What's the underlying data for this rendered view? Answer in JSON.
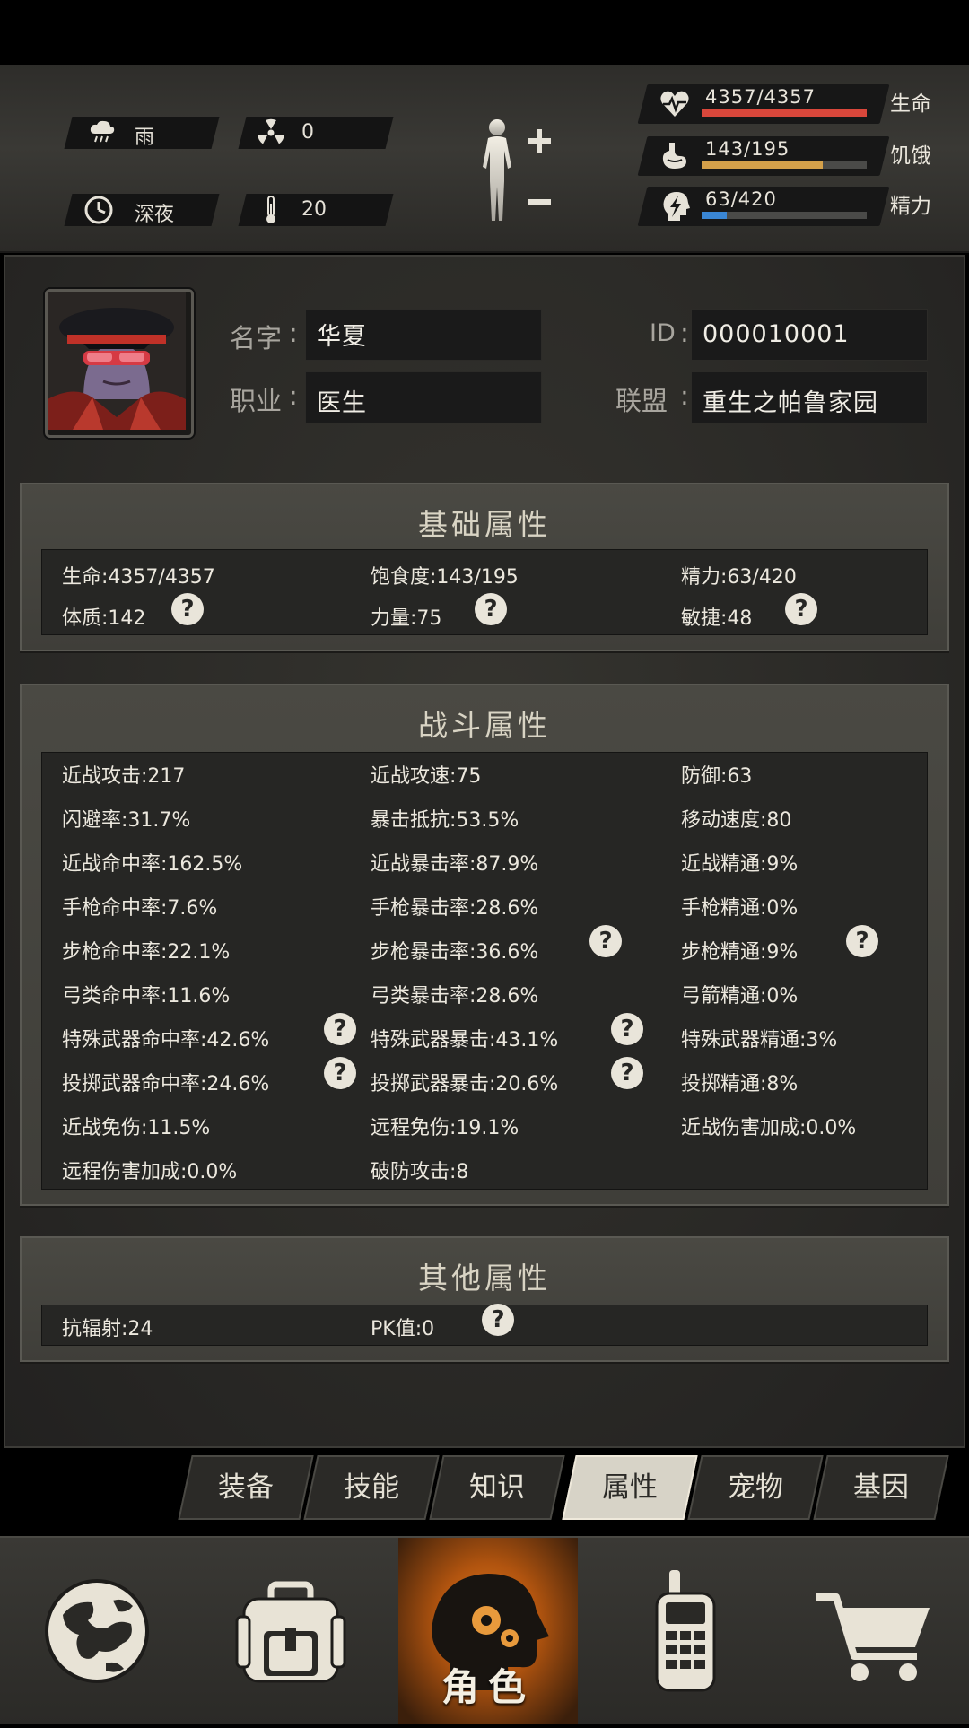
{
  "env": {
    "weather": "雨",
    "radiation": "0",
    "time": "深夜",
    "temperature": "20"
  },
  "stats": {
    "hp": {
      "value": "4357/4357",
      "label": "生命",
      "fraction": 1.0,
      "color": "#d9473b"
    },
    "hunger": {
      "value": "143/195",
      "label": "饥饿",
      "fraction": 0.733,
      "color": "#d4a04a"
    },
    "energy": {
      "value": "63/420",
      "label": "精力",
      "fraction": 0.15,
      "color": "#3a86d4"
    }
  },
  "profile": {
    "name_label": "名字",
    "name": "华夏",
    "id_label": "ID",
    "id": "000010001",
    "job_label": "职业",
    "job": "医生",
    "alliance_label": "联盟",
    "alliance": "重生之帕鲁家园"
  },
  "basic": {
    "title": "基础属性",
    "items": [
      "生命:4357/4357",
      "饱食度:143/195",
      "精力:63/420",
      "体质:142",
      "力量:75",
      "敏捷:48"
    ]
  },
  "combat": {
    "title": "战斗属性",
    "items": [
      "近战攻击:217",
      "近战攻速:75",
      "防御:63",
      "闪避率:31.7%",
      "暴击抵抗:53.5%",
      "移动速度:80",
      "近战命中率:162.5%",
      "近战暴击率:87.9%",
      "近战精通:9%",
      "手枪命中率:7.6%",
      "手枪暴击率:28.6%",
      "手枪精通:0%",
      "步枪命中率:22.1%",
      "步枪暴击率:36.6%",
      "步枪精通:9%",
      "弓类命中率:11.6%",
      "弓类暴击率:28.6%",
      "弓箭精通:0%",
      "特殊武器命中率:42.6%",
      "特殊武器暴击:43.1%",
      "特殊武器精通:3%",
      "投掷武器命中率:24.6%",
      "投掷武器暴击:20.6%",
      "投掷精通:8%",
      "近战免伤:11.5%",
      "远程免伤:19.1%",
      "近战伤害加成:0.0%",
      "远程伤害加成:0.0%",
      "破防攻击:8"
    ]
  },
  "other": {
    "title": "其他属性",
    "items": [
      "抗辐射:24",
      "PK值:0"
    ]
  },
  "help_glyph": "?",
  "tabs": [
    "装备",
    "技能",
    "知识",
    "属性",
    "宠物",
    "基因"
  ],
  "nav": {
    "active_label": "角色"
  }
}
